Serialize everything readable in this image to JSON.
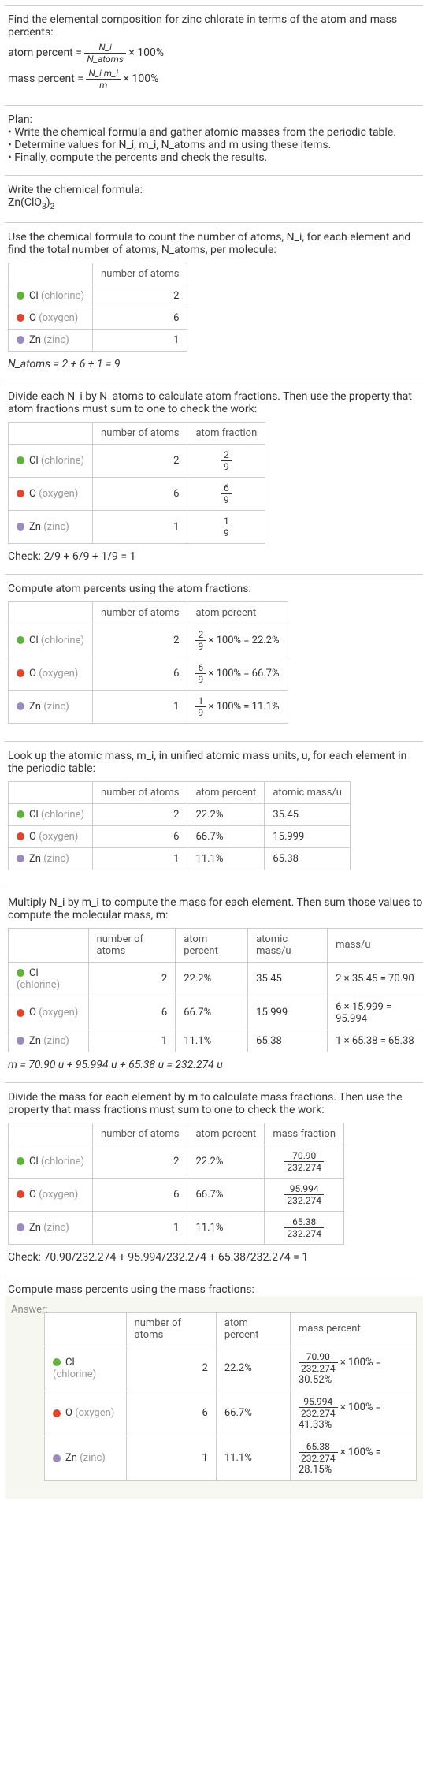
{
  "intro": "Find the elemental composition for zinc chlorate in terms of the atom and mass percents:",
  "eq_atom": "atom percent =",
  "eq_atom_frac_num": "N_i",
  "eq_atom_frac_den": "N_atoms",
  "eq_atom_tail": "× 100%",
  "eq_mass": "mass percent =",
  "eq_mass_frac_num": "N_i m_i",
  "eq_mass_frac_den": "m",
  "eq_mass_tail": "× 100%",
  "plan_title": "Plan:",
  "plan1": "• Write the chemical formula and gather atomic masses from the periodic table.",
  "plan2": "• Determine values for N_i, m_i, N_atoms and m using these items.",
  "plan3": "• Finally, compute the percents and check the results.",
  "write_formula": "Write the chemical formula:",
  "formula": "Zn(ClO3)2",
  "count_text": "Use the chemical formula to count the number of atoms, N_i, for each element and find the total number of atoms, N_atoms, per molecule:",
  "hdr_atoms": "number of atoms",
  "hdr_frac": "atom fraction",
  "hdr_pct": "atom percent",
  "hdr_mass": "atomic mass/u",
  "hdr_massu": "mass/u",
  "hdr_massfrac": "mass fraction",
  "hdr_masspct": "mass percent",
  "cl_label": "Cl",
  "cl_name": "(chlorine)",
  "o_label": "O",
  "o_name": "(oxygen)",
  "zn_label": "Zn",
  "zn_name": "(zinc)",
  "cl_n": "2",
  "o_n": "6",
  "zn_n": "1",
  "n_atoms_eq": "N_atoms = 2 + 6 + 1 = 9",
  "divide_text": "Divide each N_i by N_atoms to calculate atom fractions. Then use the property that atom fractions must sum to one to check the work:",
  "cl_frac_n": "2",
  "cl_frac_d": "9",
  "o_frac_n": "6",
  "o_frac_d": "9",
  "zn_frac_n": "1",
  "zn_frac_d": "9",
  "check_frac": "Check: 2/9 + 6/9 + 1/9 = 1",
  "atom_pct_text": "Compute atom percents using the atom fractions:",
  "cl_pct_expr": "× 100% = 22.2%",
  "o_pct_expr": "× 100% = 66.7%",
  "zn_pct_expr": "× 100% = 11.1%",
  "lookup_text": "Look up the atomic mass, m_i, in unified atomic mass units, u, for each element in the periodic table:",
  "cl_pct": "22.2%",
  "o_pct": "66.7%",
  "zn_pct": "11.1%",
  "cl_mass": "35.45",
  "o_mass": "15.999",
  "zn_mass": "65.38",
  "mult_text": "Multiply N_i by m_i to compute the mass for each element. Then sum those values to compute the molecular mass, m:",
  "cl_massu": "2 × 35.45 = 70.90",
  "o_massu": "6 × 15.999 = 95.994",
  "zn_massu": "1 × 65.38 = 65.38",
  "m_eq": "m = 70.90 u + 95.994 u + 65.38 u = 232.274 u",
  "massfrac_text": "Divide the mass for each element by m to calculate mass fractions. Then use the property that mass fractions must sum to one to check the work:",
  "cl_mf_n": "70.90",
  "cl_mf_d": "232.274",
  "o_mf_n": "95.994",
  "o_mf_d": "232.274",
  "zn_mf_n": "65.38",
  "zn_mf_d": "232.274",
  "check_mass": "Check: 70.90/232.274 + 95.994/232.274 + 65.38/232.274 = 1",
  "masspct_text": "Compute mass percents using the mass fractions:",
  "answer_label": "Answer:",
  "cl_mp": "× 100% = 30.52%",
  "o_mp": "× 100% = 41.33%",
  "zn_mp": "× 100% = 28.15%",
  "chart_data": {
    "type": "table",
    "title": "Zinc chlorate elemental composition",
    "molecular_mass_u": 232.274,
    "N_atoms": 9,
    "elements": [
      {
        "symbol": "Cl",
        "name": "chlorine",
        "atoms": 2,
        "atom_fraction": "2/9",
        "atom_percent": 22.2,
        "atomic_mass_u": 35.45,
        "mass_u": 70.9,
        "mass_fraction": "70.90/232.274",
        "mass_percent": 30.52
      },
      {
        "symbol": "O",
        "name": "oxygen",
        "atoms": 6,
        "atom_fraction": "6/9",
        "atom_percent": 66.7,
        "atomic_mass_u": 15.999,
        "mass_u": 95.994,
        "mass_fraction": "95.994/232.274",
        "mass_percent": 41.33
      },
      {
        "symbol": "Zn",
        "name": "zinc",
        "atoms": 1,
        "atom_fraction": "1/9",
        "atom_percent": 11.1,
        "atomic_mass_u": 65.38,
        "mass_u": 65.38,
        "mass_fraction": "65.38/232.274",
        "mass_percent": 28.15
      }
    ]
  }
}
